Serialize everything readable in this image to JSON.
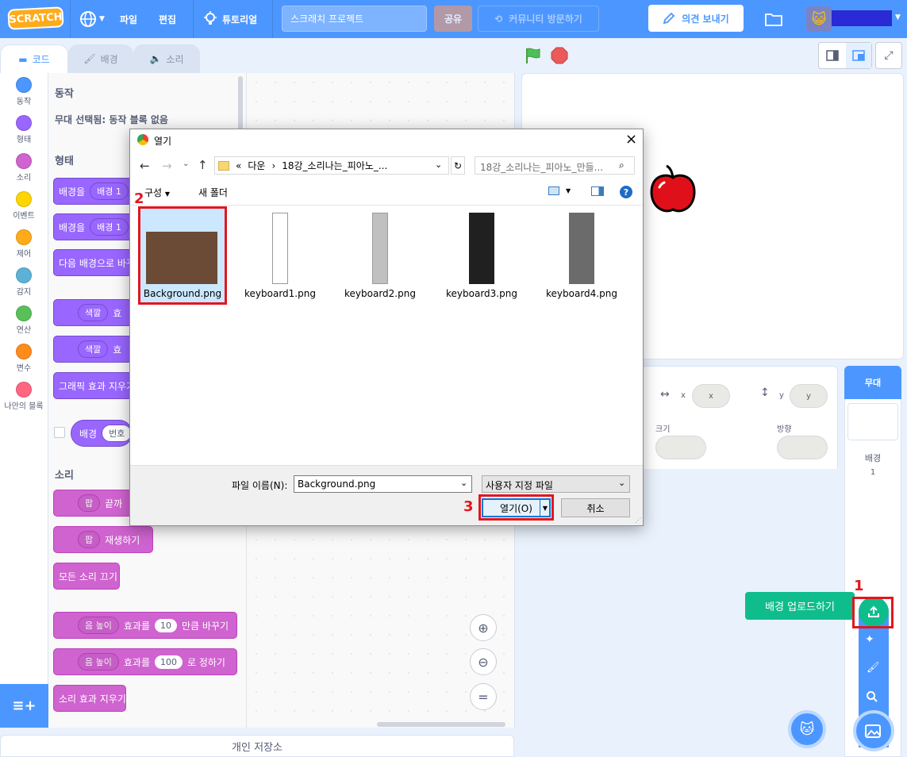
{
  "menubar": {
    "logo": "SCRATCH",
    "file": "파일",
    "edit": "편집",
    "tutorial": "튜토리얼",
    "project_title": "스크래치 프로젝트",
    "share": "공유",
    "community": "커뮤니티 방문하기",
    "feedback": "의견 보내기"
  },
  "tabs": {
    "code": "코드",
    "costumes": "배경",
    "sounds": "소리"
  },
  "categories": [
    {
      "label": "동작",
      "color": "#4c97ff"
    },
    {
      "label": "형태",
      "color": "#9966ff"
    },
    {
      "label": "소리",
      "color": "#cf63cf"
    },
    {
      "label": "이벤트",
      "color": "#ffd500"
    },
    {
      "label": "제어",
      "color": "#ffab19"
    },
    {
      "label": "감지",
      "color": "#5cb1d6"
    },
    {
      "label": "연산",
      "color": "#59c059"
    },
    {
      "label": "변수",
      "color": "#ff8c1a"
    },
    {
      "label": "나만의 블록",
      "color": "#ff6680"
    }
  ],
  "palette": {
    "motion_heading": "동작",
    "motion_note": "무대 선택됨: 동작 블록 없음",
    "looks_heading": "형태",
    "b1_text": "배경을",
    "b1_pill": "배경 1",
    "b2_text": "배경을",
    "b2_pill": "배경 1",
    "b3_text": "다음 배경으로 바꾸기",
    "b4_pill": "색깔",
    "b4_text": "효",
    "b5_pill": "색깔",
    "b5_text": "효",
    "b6_text": "그래픽 효과 지우기",
    "b7_text": "배경",
    "b7_pill": "번호",
    "sound_heading": "소리",
    "s1_pill": "팝",
    "s1_text": "끝까",
    "s2_pill": "팝",
    "s2_text": "재생하기",
    "s3_text": "모든 소리 끄기",
    "s4_pill": "음 높이",
    "s4_mid": "효과를",
    "s4_val": "10",
    "s4_end": "만큼 바꾸기",
    "s5_pill": "음 높이",
    "s5_mid": "효과를",
    "s5_val": "100",
    "s5_end": "로 정하기",
    "s6_text": "소리 효과 지우기"
  },
  "backpack": "개인 저장소",
  "sprite_info": {
    "x_label": "x",
    "x_value": "x",
    "y_label": "y",
    "y_value": "y",
    "size_label": "크기",
    "direction_label": "방향"
  },
  "stage_panel": {
    "title": "무대",
    "backdrops_label": "배경",
    "backdrops_count": "1"
  },
  "tooltip": "배경 업로드하기",
  "dialog": {
    "title": "열기",
    "path_prefix": "«",
    "path_1": "다운",
    "path_2": "18강_소리나는_피아노_...",
    "search_placeholder": "18강_소리나는_피아노_만들...",
    "organize": "구성",
    "new_folder": "새 폴더",
    "files": [
      {
        "name": "Background.png",
        "color": "#6b4a36"
      },
      {
        "name": "keyboard1.png",
        "color": "#ffffff"
      },
      {
        "name": "keyboard2.png",
        "color": "#c0c0c0"
      },
      {
        "name": "keyboard3.png",
        "color": "#202020"
      },
      {
        "name": "keyboard4.png",
        "color": "#6b6b6b"
      }
    ],
    "filename_label": "파일 이름(N):",
    "filename_value": "Background.png",
    "filetype": "사용자 지정 파일",
    "open": "열기(O)",
    "cancel": "취소"
  },
  "annotations": {
    "n1": "1",
    "n2": "2",
    "n3": "3"
  }
}
